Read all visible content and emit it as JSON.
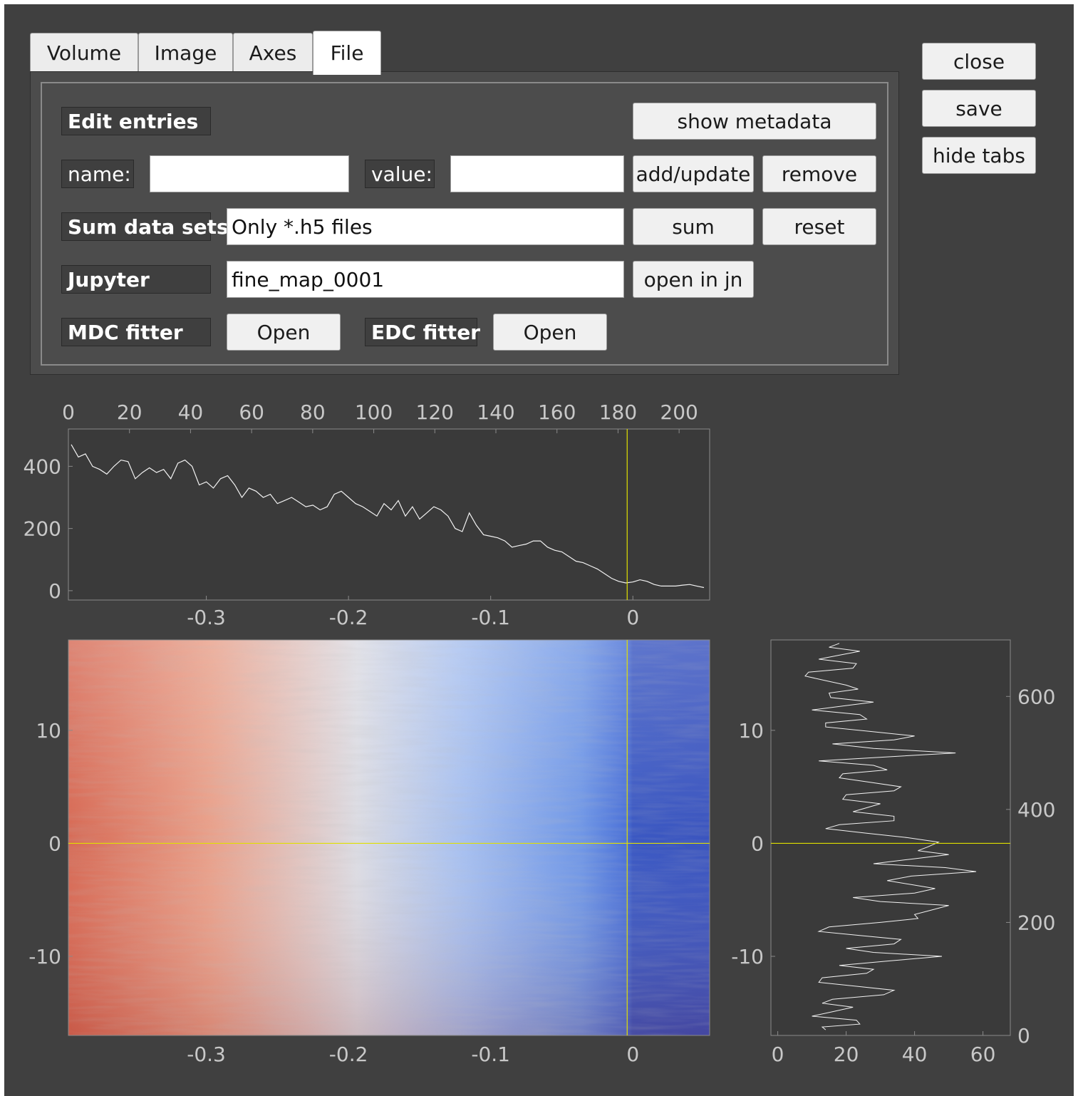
{
  "tabs": [
    {
      "label": "Volume",
      "active": false
    },
    {
      "label": "Image",
      "active": false
    },
    {
      "label": "Axes",
      "active": false
    },
    {
      "label": "File",
      "active": true
    }
  ],
  "side_buttons": {
    "close": "close",
    "save": "save",
    "hide_tabs": "hide tabs"
  },
  "file_panel": {
    "edit_entries_label": "Edit entries",
    "show_metadata_button": "show metadata",
    "name_label": "name:",
    "name_value": "",
    "value_label": "value:",
    "value_value": "",
    "add_update_button": "add/update",
    "remove_button": "remove",
    "sum_label": "Sum data sets",
    "sum_input": "Only *.h5 files",
    "sum_button": "sum",
    "reset_button": "reset",
    "jupyter_label": "Jupyter",
    "jupyter_input": "fine_map_0001",
    "open_jn_button": "open in jn",
    "mdc_label": "MDC fitter",
    "mdc_open_button": "Open",
    "edc_label": "EDC fitter",
    "edc_open_button": "Open"
  },
  "colors": {
    "window_bg": "#404040",
    "plot_bg": "#3a3a3a",
    "tick_text": "#c8c8c8",
    "cursor": "#e0e000",
    "curve": "#f2f2f2"
  },
  "chart_data": [
    {
      "id": "edc",
      "type": "line",
      "title": "",
      "xlabel": "",
      "ylabel": "",
      "x_bottom_ticks": [
        "-0.3",
        "-0.2",
        "-0.1",
        "0"
      ],
      "x_top_ticks": [
        "0",
        "20",
        "40",
        "60",
        "80",
        "100",
        "120",
        "140",
        "160",
        "180",
        "200"
      ],
      "y_ticks": [
        "0",
        "200",
        "400"
      ],
      "xlim": [
        -0.397,
        0.054
      ],
      "ylim": [
        -30,
        520
      ],
      "x_top_range": [
        0,
        210
      ],
      "cursor_x": -0.004,
      "x": [
        -0.395,
        -0.39,
        -0.385,
        -0.38,
        -0.375,
        -0.37,
        -0.365,
        -0.36,
        -0.355,
        -0.35,
        -0.345,
        -0.34,
        -0.335,
        -0.33,
        -0.325,
        -0.32,
        -0.315,
        -0.31,
        -0.305,
        -0.3,
        -0.295,
        -0.29,
        -0.285,
        -0.28,
        -0.275,
        -0.27,
        -0.265,
        -0.26,
        -0.255,
        -0.25,
        -0.245,
        -0.24,
        -0.235,
        -0.23,
        -0.225,
        -0.22,
        -0.215,
        -0.21,
        -0.205,
        -0.2,
        -0.195,
        -0.19,
        -0.185,
        -0.18,
        -0.175,
        -0.17,
        -0.165,
        -0.16,
        -0.155,
        -0.15,
        -0.145,
        -0.14,
        -0.135,
        -0.13,
        -0.125,
        -0.12,
        -0.115,
        -0.11,
        -0.105,
        -0.1,
        -0.095,
        -0.09,
        -0.085,
        -0.08,
        -0.075,
        -0.07,
        -0.065,
        -0.06,
        -0.055,
        -0.05,
        -0.045,
        -0.04,
        -0.035,
        -0.03,
        -0.025,
        -0.02,
        -0.015,
        -0.01,
        -0.005,
        0.0,
        0.005,
        0.01,
        0.015,
        0.02,
        0.025,
        0.03,
        0.035,
        0.04,
        0.045,
        0.05
      ],
      "y": [
        470,
        430,
        440,
        400,
        390,
        375,
        400,
        420,
        415,
        360,
        380,
        395,
        380,
        390,
        360,
        410,
        420,
        400,
        340,
        350,
        330,
        360,
        370,
        340,
        300,
        330,
        320,
        300,
        310,
        280,
        290,
        300,
        285,
        270,
        275,
        260,
        270,
        310,
        320,
        300,
        280,
        270,
        255,
        240,
        280,
        260,
        290,
        240,
        270,
        230,
        250,
        270,
        260,
        240,
        200,
        190,
        250,
        210,
        180,
        175,
        170,
        160,
        140,
        145,
        150,
        160,
        160,
        140,
        130,
        125,
        110,
        95,
        90,
        80,
        70,
        55,
        40,
        30,
        25,
        28,
        35,
        30,
        20,
        15,
        15,
        15,
        18,
        20,
        15,
        10
      ]
    },
    {
      "id": "map",
      "type": "heatmap",
      "title": "",
      "xlabel": "",
      "ylabel": "",
      "x_ticks": [
        "-0.3",
        "-0.2",
        "-0.1",
        "0"
      ],
      "y_ticks": [
        "-10",
        "0",
        "10"
      ],
      "xlim": [
        -0.397,
        0.054
      ],
      "ylim": [
        -17,
        18
      ],
      "cursor_x": -0.004,
      "cursor_y": 0,
      "colormap": "coolwarm"
    },
    {
      "id": "mdc",
      "type": "line",
      "title": "",
      "xlabel": "",
      "ylabel": "",
      "x_ticks": [
        "0",
        "20",
        "40",
        "60"
      ],
      "y_left_ticks": [
        "-10",
        "0",
        "10"
      ],
      "y_right_ticks": [
        "0",
        "200",
        "400",
        "600"
      ],
      "xlim": [
        -2,
        68
      ],
      "ylim": [
        -17,
        18
      ],
      "y_right_range": [
        0,
        700
      ],
      "cursor_y": 0,
      "y": [
        17.7,
        17.0,
        16.3,
        15.5,
        14.8,
        14.0,
        13.3,
        12.5,
        11.8,
        11.0,
        10.3,
        9.5,
        8.8,
        8.0,
        7.3,
        6.5,
        5.8,
        5.0,
        4.3,
        3.5,
        2.8,
        2.0,
        1.3,
        0.5,
        -0.3,
        -1.0,
        -1.8,
        -2.5,
        -3.3,
        -4.0,
        -4.8,
        -5.5,
        -6.3,
        -7.0,
        -7.8,
        -8.5,
        -9.3,
        -10.0,
        -10.8,
        -11.5,
        -12.3,
        -13.0,
        -13.8,
        -14.5,
        -15.3,
        -16.0,
        -16.5
      ],
      "x": [
        18,
        24,
        12,
        22,
        8,
        20,
        15,
        28,
        10,
        26,
        14,
        40,
        16,
        52,
        12,
        32,
        18,
        36,
        20,
        30,
        22,
        34,
        14,
        38,
        44,
        50,
        28,
        58,
        32,
        46,
        22,
        50,
        40,
        30,
        12,
        36,
        20,
        48,
        18,
        26,
        12,
        34,
        16,
        22,
        10,
        24,
        14
      ]
    }
  ]
}
